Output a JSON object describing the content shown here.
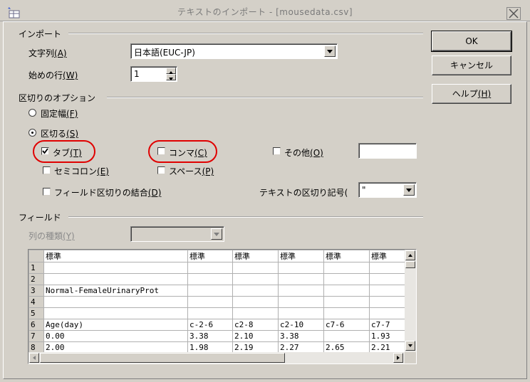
{
  "window": {
    "title": "テキストのインポート - [mousedata.csv]"
  },
  "import_section": {
    "heading": "インポート",
    "charset_label": "文字列",
    "charset_key": "(A)",
    "charset_value": "日本語(EUC-JP)",
    "start_row_label": "始めの行",
    "start_row_key": "(W)",
    "start_row_value": "1"
  },
  "separator_section": {
    "heading": "区切りのオプション",
    "fixed_width_label": "固定幅",
    "fixed_width_key": "(F)",
    "fixed_width_selected": false,
    "separated_label": "区切る",
    "separated_key": "(S)",
    "separated_selected": true,
    "tab_label": "タブ",
    "tab_key": "(T)",
    "tab_checked": true,
    "comma_label": "コンマ",
    "comma_key": "(C)",
    "comma_checked": false,
    "other_label": "その他",
    "other_key": "(O)",
    "other_checked": false,
    "other_value": "",
    "semicolon_label": "セミコロン",
    "semicolon_key": "(E)",
    "semicolon_checked": false,
    "space_label": "スペース",
    "space_key": "(P)",
    "space_checked": false,
    "merge_label": "フィールド区切りの結合",
    "merge_key": "(D)",
    "merge_checked": false,
    "text_delim_label": "テキストの区切り記号(",
    "text_delim_value": "\""
  },
  "fields_section": {
    "heading": "フィールド",
    "column_type_label": "列の種類",
    "column_type_key": "(Y)",
    "column_type_value": "",
    "columns": [
      "標準",
      "標準",
      "標準",
      "標準",
      "標準"
    ],
    "rows": [
      {
        "num": "1",
        "cells": [
          "",
          "",
          "",
          "",
          ""
        ]
      },
      {
        "num": "2",
        "cells": [
          "",
          "",
          "",
          "",
          ""
        ]
      },
      {
        "num": "3",
        "cells": [
          "Normal-FemaleUrinaryProt",
          "",
          "",
          "",
          ""
        ]
      },
      {
        "num": "4",
        "cells": [
          "",
          "",
          "",
          "",
          ""
        ]
      },
      {
        "num": "5",
        "cells": [
          "",
          "",
          "",
          "",
          ""
        ]
      },
      {
        "num": "6",
        "cells": [
          "Age(day)",
          "c-2-6",
          "c2-8",
          "c2-10",
          "c7-6",
          "c7-7"
        ]
      },
      {
        "num": "7",
        "cells": [
          "0.00",
          "3.38",
          "2.10",
          "3.38",
          "",
          "1.93"
        ]
      },
      {
        "num": "8",
        "cells": [
          "2.00",
          "1.98",
          "2.19",
          "2.27",
          "2.65",
          "2.21"
        ]
      }
    ]
  },
  "buttons": {
    "ok": "OK",
    "cancel": "キャンセル",
    "help": "ヘルプ",
    "help_key": "(H)"
  },
  "colors": {
    "highlight_ring": "#e00000",
    "dialog_bg": "#d4d0c8"
  }
}
